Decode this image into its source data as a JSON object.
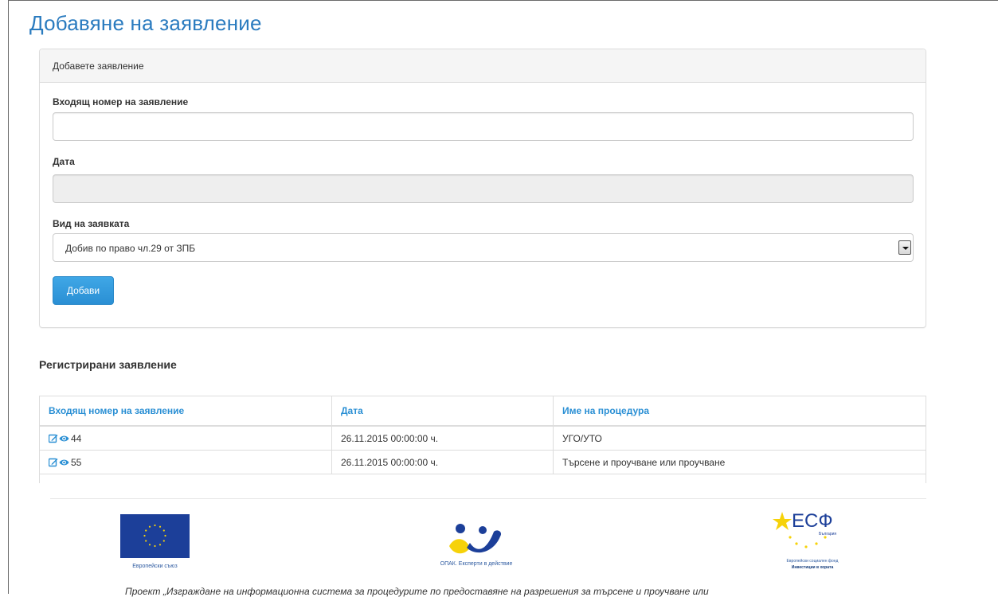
{
  "page": {
    "title": "Добавяне на заявление"
  },
  "form": {
    "panel_heading": "Добавете заявление",
    "incoming_number": {
      "label": "Входящ номер на заявление",
      "value": ""
    },
    "date": {
      "label": "Дата",
      "value": ""
    },
    "request_type": {
      "label": "Вид на заявката",
      "selected": "Добив по право чл.29 от ЗПБ"
    },
    "submit_label": "Добави"
  },
  "registered": {
    "title": "Регистрирани заявление",
    "columns": [
      "Входящ номер на заявление",
      "Дата",
      "Име на процедура"
    ],
    "rows": [
      {
        "number": "44",
        "date": "26.11.2015 00:00:00 ч.",
        "procedure": "УГО/УТО"
      },
      {
        "number": "55",
        "date": "26.11.2015 00:00:00 ч.",
        "procedure": "Търсене и проучване или проучване"
      }
    ]
  },
  "footer": {
    "eu_caption": "Европейски съюз",
    "opak_caption": "ОПАК. Експерти в действие",
    "esf_mark": "ЕСФ",
    "esf_country": "България",
    "esf_caption": "Европейски социален фонд",
    "esf_slogan": "Инвестиции в хората",
    "project_text": "Проект „Изграждане на информационна система за процедурите по предоставяне на разрешения за търсене и проучване или"
  },
  "colors": {
    "accent": "#2a8fd4",
    "title": "#2a7bbf",
    "eu_blue": "#1c3f99",
    "esf_yellow": "#f6d20a"
  }
}
